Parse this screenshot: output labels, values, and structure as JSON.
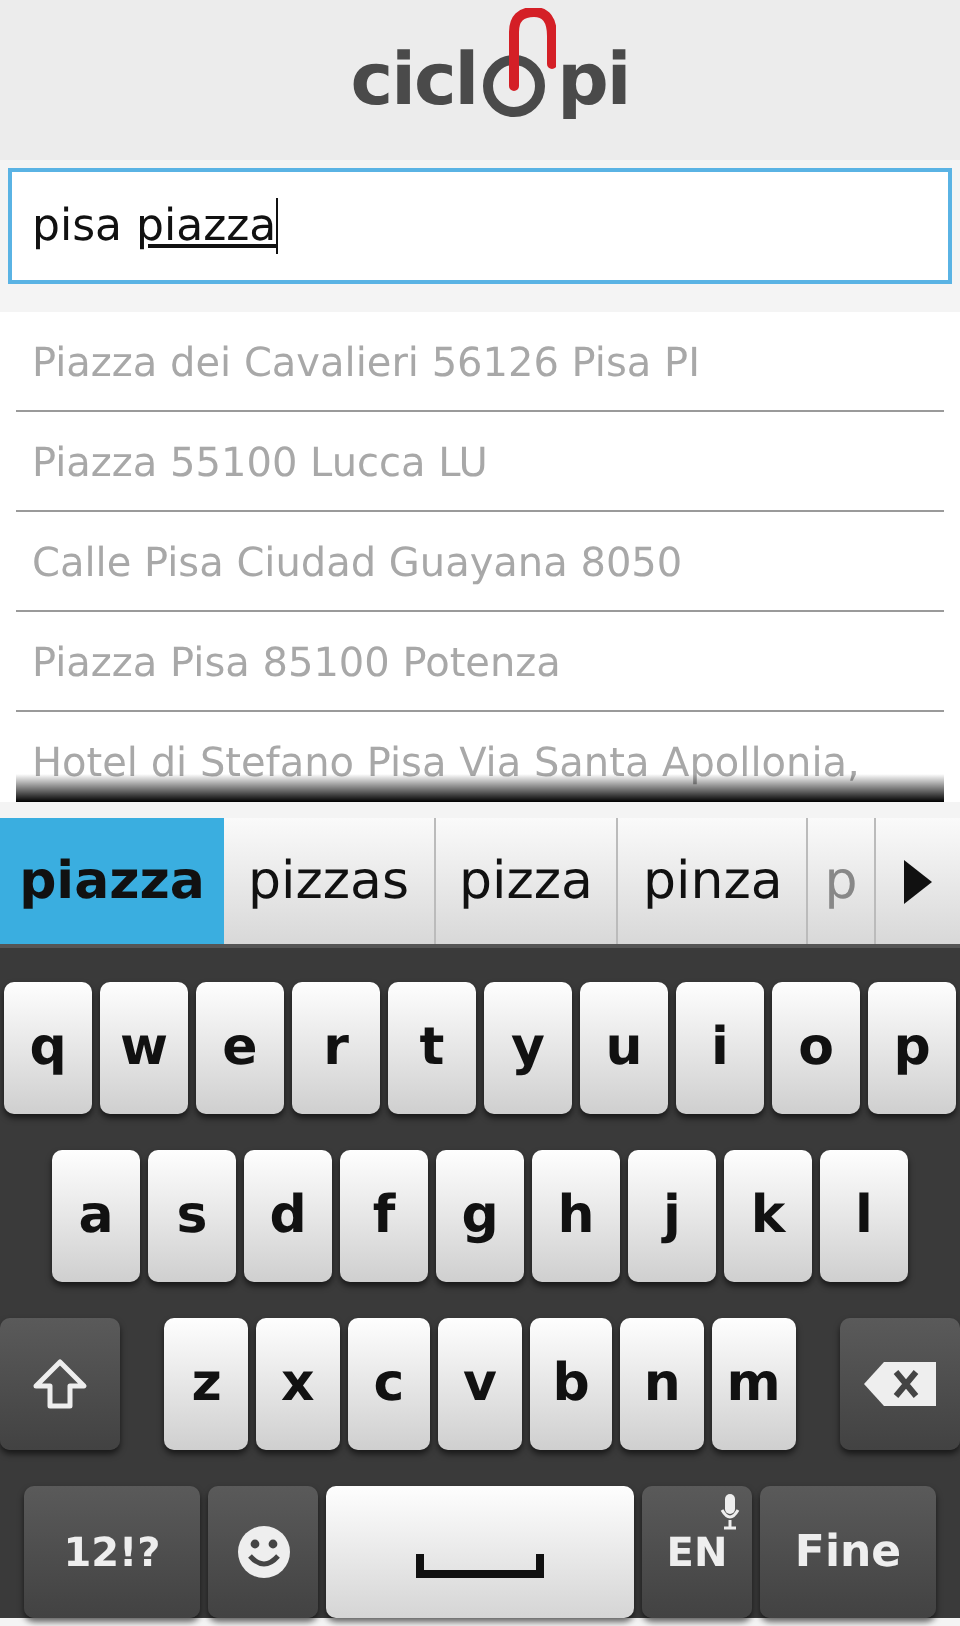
{
  "logo": {
    "left": "cicl",
    "right": "pi"
  },
  "search": {
    "value": "pisa ",
    "composing": "piazza"
  },
  "results": [
    {
      "label": "Piazza dei Cavalieri 56126 Pisa PI"
    },
    {
      "label": "Piazza 55100 Lucca LU"
    },
    {
      "label": "Calle Pisa Ciudad Guayana 8050"
    },
    {
      "label": "Piazza Pisa 85100 Potenza"
    },
    {
      "label": "Hotel di Stefano Pisa Via Santa Apollonia,"
    }
  ],
  "suggestions": [
    {
      "label": "piazza",
      "selected": true
    },
    {
      "label": "pizzas",
      "selected": false
    },
    {
      "label": "pizza",
      "selected": false
    },
    {
      "label": "pinza",
      "selected": false
    },
    {
      "label": "p",
      "selected": false
    }
  ],
  "keyboard": {
    "rows": [
      {
        "keys": [
          {
            "kind": "letter",
            "label": "q"
          },
          {
            "kind": "letter",
            "label": "w"
          },
          {
            "kind": "letter",
            "label": "e"
          },
          {
            "kind": "letter",
            "label": "r"
          },
          {
            "kind": "letter",
            "label": "t"
          },
          {
            "kind": "letter",
            "label": "y"
          },
          {
            "kind": "letter",
            "label": "u"
          },
          {
            "kind": "letter",
            "label": "i"
          },
          {
            "kind": "letter",
            "label": "o"
          },
          {
            "kind": "letter",
            "label": "p"
          }
        ]
      },
      {
        "keys": [
          {
            "kind": "letter",
            "label": "a"
          },
          {
            "kind": "letter",
            "label": "s"
          },
          {
            "kind": "letter",
            "label": "d"
          },
          {
            "kind": "letter",
            "label": "f"
          },
          {
            "kind": "letter",
            "label": "g"
          },
          {
            "kind": "letter",
            "label": "h"
          },
          {
            "kind": "letter",
            "label": "j"
          },
          {
            "kind": "letter",
            "label": "k"
          },
          {
            "kind": "letter",
            "label": "l"
          }
        ]
      },
      {
        "keys": [
          {
            "kind": "shift"
          },
          {
            "kind": "letter",
            "label": "z"
          },
          {
            "kind": "letter",
            "label": "x"
          },
          {
            "kind": "letter",
            "label": "c"
          },
          {
            "kind": "letter",
            "label": "v"
          },
          {
            "kind": "letter",
            "label": "b"
          },
          {
            "kind": "letter",
            "label": "n"
          },
          {
            "kind": "letter",
            "label": "m"
          },
          {
            "kind": "backspace"
          }
        ]
      },
      {
        "keys": [
          {
            "kind": "symbols",
            "label": "12!?"
          },
          {
            "kind": "emoji"
          },
          {
            "kind": "space"
          },
          {
            "kind": "language",
            "label": "EN"
          },
          {
            "kind": "done",
            "label": "Fine"
          }
        ]
      }
    ]
  }
}
